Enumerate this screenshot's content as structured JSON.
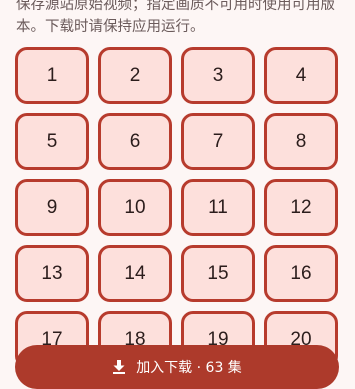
{
  "description": "保存源站原始视频；指定画质不可用时使用可用版本。下载时请保持应用运行。",
  "episodes": [
    "1",
    "2",
    "3",
    "4",
    "5",
    "6",
    "7",
    "8",
    "9",
    "10",
    "11",
    "12",
    "13",
    "14",
    "15",
    "16",
    "17",
    "18",
    "19",
    "20"
  ],
  "download_button": {
    "label": "加入下载 · 63 集",
    "icon": "download-icon"
  },
  "colors": {
    "accent": "#b73b2d",
    "cell_fill": "#fde0dc",
    "button_bg": "#ad3a2b",
    "page_bg": "#fdf6f5"
  }
}
